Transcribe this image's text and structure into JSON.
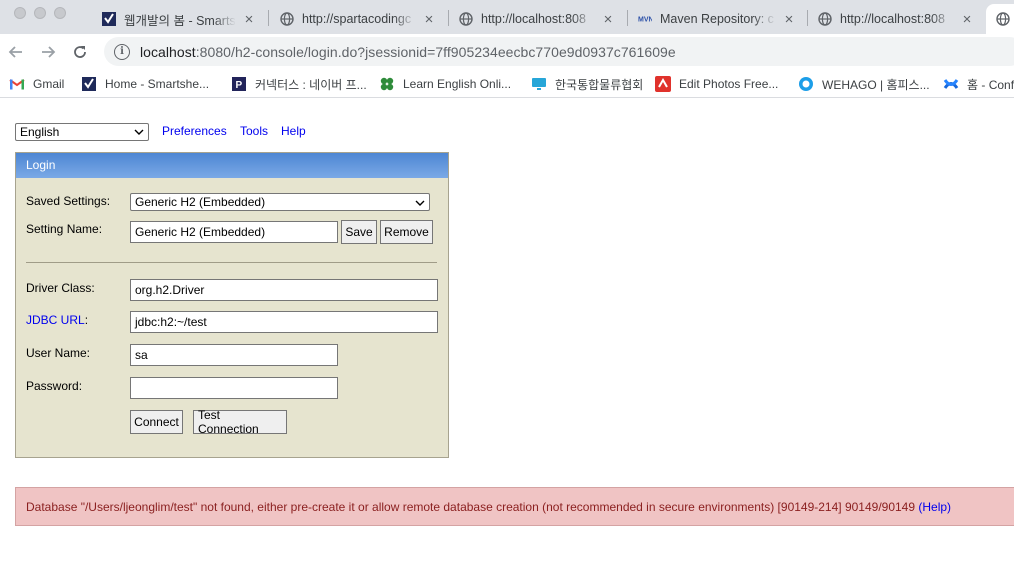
{
  "browser": {
    "tabs": [
      {
        "title": "웹개발의 봄 - Smartsh",
        "icon": "smartsheet-icon"
      },
      {
        "title": "http://spartacodingc",
        "icon": "globe-icon"
      },
      {
        "title": "http://localhost:808",
        "icon": "globe-icon"
      },
      {
        "title": "Maven Repository: c",
        "icon": "maven-icon"
      },
      {
        "title": "http://localhost:808",
        "icon": "globe-icon"
      }
    ],
    "address": {
      "host": "localhost",
      "rest": ":8080/h2-console/login.do?jsessionid=7ff905234eecbc770e9d0937c761609e"
    },
    "bookmarks": [
      {
        "label": "Gmail",
        "icon": "gmail-icon"
      },
      {
        "label": "Home - Smartshe...",
        "icon": "smartsheet-icon"
      },
      {
        "label": "커넥터스 : 네이버 프...",
        "icon": "p-icon"
      },
      {
        "label": "Learn English Onli...",
        "icon": "clover-icon"
      },
      {
        "label": "한국통합물류협회",
        "icon": "monitor-icon"
      },
      {
        "label": "Edit Photos Free...",
        "icon": "photo-edit-icon"
      },
      {
        "label": "WEHAGO | 홈피스...",
        "icon": "wehago-icon"
      },
      {
        "label": "홈 - Conf",
        "icon": "confluence-icon"
      }
    ]
  },
  "topbar": {
    "language": "English",
    "links": [
      "Preferences",
      "Tools",
      "Help"
    ]
  },
  "login": {
    "header": "Login",
    "saved_settings_label": "Saved Settings:",
    "saved_settings_value": "Generic H2 (Embedded)",
    "setting_name_label": "Setting Name:",
    "setting_name_value": "Generic H2 (Embedded)",
    "save_button": "Save",
    "remove_button": "Remove",
    "driver_class_label": "Driver Class:",
    "driver_class_value": "org.h2.Driver",
    "jdbc_url_label": "JDBC URL",
    "jdbc_url_colon": ":",
    "jdbc_url_value": "jdbc:h2:~/test",
    "user_name_label": "User Name:",
    "user_name_value": "sa",
    "password_label": "Password:",
    "password_value": "",
    "connect_button": "Connect",
    "test_connection_button": "Test Connection"
  },
  "error": {
    "message": "Database \"/Users/ljeonglim/test\" not found, either pre-create it or allow remote database creation (not recommended in secure environments) [90149-214] 90149/90149",
    "help_link": "(Help)"
  }
}
